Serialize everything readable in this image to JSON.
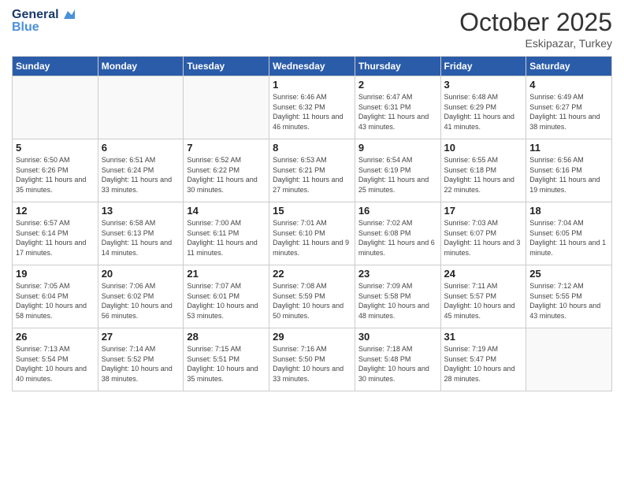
{
  "header": {
    "logo_line1": "General",
    "logo_line2": "Blue",
    "month": "October 2025",
    "location": "Eskipazar, Turkey"
  },
  "weekdays": [
    "Sunday",
    "Monday",
    "Tuesday",
    "Wednesday",
    "Thursday",
    "Friday",
    "Saturday"
  ],
  "weeks": [
    [
      {
        "num": "",
        "info": "",
        "empty": true
      },
      {
        "num": "",
        "info": "",
        "empty": true
      },
      {
        "num": "",
        "info": "",
        "empty": true
      },
      {
        "num": "1",
        "info": "Sunrise: 6:46 AM\nSunset: 6:32 PM\nDaylight: 11 hours\nand 46 minutes."
      },
      {
        "num": "2",
        "info": "Sunrise: 6:47 AM\nSunset: 6:31 PM\nDaylight: 11 hours\nand 43 minutes."
      },
      {
        "num": "3",
        "info": "Sunrise: 6:48 AM\nSunset: 6:29 PM\nDaylight: 11 hours\nand 41 minutes."
      },
      {
        "num": "4",
        "info": "Sunrise: 6:49 AM\nSunset: 6:27 PM\nDaylight: 11 hours\nand 38 minutes."
      }
    ],
    [
      {
        "num": "5",
        "info": "Sunrise: 6:50 AM\nSunset: 6:26 PM\nDaylight: 11 hours\nand 35 minutes."
      },
      {
        "num": "6",
        "info": "Sunrise: 6:51 AM\nSunset: 6:24 PM\nDaylight: 11 hours\nand 33 minutes."
      },
      {
        "num": "7",
        "info": "Sunrise: 6:52 AM\nSunset: 6:22 PM\nDaylight: 11 hours\nand 30 minutes."
      },
      {
        "num": "8",
        "info": "Sunrise: 6:53 AM\nSunset: 6:21 PM\nDaylight: 11 hours\nand 27 minutes."
      },
      {
        "num": "9",
        "info": "Sunrise: 6:54 AM\nSunset: 6:19 PM\nDaylight: 11 hours\nand 25 minutes."
      },
      {
        "num": "10",
        "info": "Sunrise: 6:55 AM\nSunset: 6:18 PM\nDaylight: 11 hours\nand 22 minutes."
      },
      {
        "num": "11",
        "info": "Sunrise: 6:56 AM\nSunset: 6:16 PM\nDaylight: 11 hours\nand 19 minutes."
      }
    ],
    [
      {
        "num": "12",
        "info": "Sunrise: 6:57 AM\nSunset: 6:14 PM\nDaylight: 11 hours\nand 17 minutes."
      },
      {
        "num": "13",
        "info": "Sunrise: 6:58 AM\nSunset: 6:13 PM\nDaylight: 11 hours\nand 14 minutes."
      },
      {
        "num": "14",
        "info": "Sunrise: 7:00 AM\nSunset: 6:11 PM\nDaylight: 11 hours\nand 11 minutes."
      },
      {
        "num": "15",
        "info": "Sunrise: 7:01 AM\nSunset: 6:10 PM\nDaylight: 11 hours\nand 9 minutes."
      },
      {
        "num": "16",
        "info": "Sunrise: 7:02 AM\nSunset: 6:08 PM\nDaylight: 11 hours\nand 6 minutes."
      },
      {
        "num": "17",
        "info": "Sunrise: 7:03 AM\nSunset: 6:07 PM\nDaylight: 11 hours\nand 3 minutes."
      },
      {
        "num": "18",
        "info": "Sunrise: 7:04 AM\nSunset: 6:05 PM\nDaylight: 11 hours\nand 1 minute."
      }
    ],
    [
      {
        "num": "19",
        "info": "Sunrise: 7:05 AM\nSunset: 6:04 PM\nDaylight: 10 hours\nand 58 minutes."
      },
      {
        "num": "20",
        "info": "Sunrise: 7:06 AM\nSunset: 6:02 PM\nDaylight: 10 hours\nand 56 minutes."
      },
      {
        "num": "21",
        "info": "Sunrise: 7:07 AM\nSunset: 6:01 PM\nDaylight: 10 hours\nand 53 minutes."
      },
      {
        "num": "22",
        "info": "Sunrise: 7:08 AM\nSunset: 5:59 PM\nDaylight: 10 hours\nand 50 minutes."
      },
      {
        "num": "23",
        "info": "Sunrise: 7:09 AM\nSunset: 5:58 PM\nDaylight: 10 hours\nand 48 minutes."
      },
      {
        "num": "24",
        "info": "Sunrise: 7:11 AM\nSunset: 5:57 PM\nDaylight: 10 hours\nand 45 minutes."
      },
      {
        "num": "25",
        "info": "Sunrise: 7:12 AM\nSunset: 5:55 PM\nDaylight: 10 hours\nand 43 minutes."
      }
    ],
    [
      {
        "num": "26",
        "info": "Sunrise: 7:13 AM\nSunset: 5:54 PM\nDaylight: 10 hours\nand 40 minutes."
      },
      {
        "num": "27",
        "info": "Sunrise: 7:14 AM\nSunset: 5:52 PM\nDaylight: 10 hours\nand 38 minutes."
      },
      {
        "num": "28",
        "info": "Sunrise: 7:15 AM\nSunset: 5:51 PM\nDaylight: 10 hours\nand 35 minutes."
      },
      {
        "num": "29",
        "info": "Sunrise: 7:16 AM\nSunset: 5:50 PM\nDaylight: 10 hours\nand 33 minutes."
      },
      {
        "num": "30",
        "info": "Sunrise: 7:18 AM\nSunset: 5:48 PM\nDaylight: 10 hours\nand 30 minutes."
      },
      {
        "num": "31",
        "info": "Sunrise: 7:19 AM\nSunset: 5:47 PM\nDaylight: 10 hours\nand 28 minutes."
      },
      {
        "num": "",
        "info": "",
        "empty": true
      }
    ]
  ]
}
